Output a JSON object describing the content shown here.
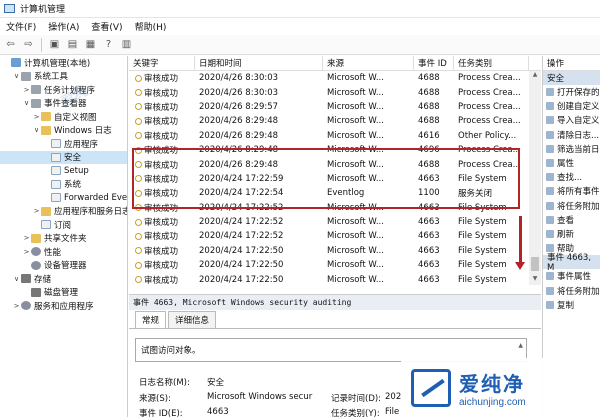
{
  "window": {
    "title": "计算机管理"
  },
  "menu": [
    "文件(F)",
    "操作(A)",
    "查看(V)",
    "帮助(H)"
  ],
  "tree": [
    {
      "label": "计算机管理(本地)",
      "indent": 0,
      "arrow": "",
      "icon": "pc"
    },
    {
      "label": "系统工具",
      "indent": 1,
      "arrow": "∨",
      "icon": "tool"
    },
    {
      "label": "任务计划程序",
      "indent": 2,
      "arrow": ">",
      "icon": "tool"
    },
    {
      "label": "事件查看器",
      "indent": 2,
      "arrow": "∨",
      "icon": "tool"
    },
    {
      "label": "自定义视图",
      "indent": 3,
      "arrow": ">",
      "icon": "folder"
    },
    {
      "label": "Windows 日志",
      "indent": 3,
      "arrow": "∨",
      "icon": "folder"
    },
    {
      "label": "应用程序",
      "indent": 4,
      "arrow": "",
      "icon": "log"
    },
    {
      "label": "安全",
      "indent": 4,
      "arrow": "",
      "icon": "log",
      "selected": true
    },
    {
      "label": "Setup",
      "indent": 4,
      "arrow": "",
      "icon": "log"
    },
    {
      "label": "系统",
      "indent": 4,
      "arrow": "",
      "icon": "log"
    },
    {
      "label": "Forwarded Eve",
      "indent": 4,
      "arrow": "",
      "icon": "log"
    },
    {
      "label": "应用程序和服务日志",
      "indent": 3,
      "arrow": ">",
      "icon": "folder"
    },
    {
      "label": "订阅",
      "indent": 3,
      "arrow": "",
      "icon": "log"
    },
    {
      "label": "共享文件夹",
      "indent": 2,
      "arrow": ">",
      "icon": "folder"
    },
    {
      "label": "性能",
      "indent": 2,
      "arrow": ">",
      "icon": "gear"
    },
    {
      "label": "设备管理器",
      "indent": 2,
      "arrow": "",
      "icon": "gear"
    },
    {
      "label": "存储",
      "indent": 1,
      "arrow": "∨",
      "icon": "disk"
    },
    {
      "label": "磁盘管理",
      "indent": 2,
      "arrow": "",
      "icon": "disk"
    },
    {
      "label": "服务和应用程序",
      "indent": 1,
      "arrow": ">",
      "icon": "gear"
    }
  ],
  "grid": {
    "headers": [
      "关键字",
      "日期和时间",
      "来源",
      "事件 ID",
      "任务类别"
    ],
    "rows": [
      [
        "审核成功",
        "2020/4/26 8:30:03",
        "Microsoft W...",
        "4688",
        "Process Crea..."
      ],
      [
        "审核成功",
        "2020/4/26 8:30:03",
        "Microsoft W...",
        "4688",
        "Process Crea..."
      ],
      [
        "审核成功",
        "2020/4/26 8:29:57",
        "Microsoft W...",
        "4688",
        "Process Crea..."
      ],
      [
        "审核成功",
        "2020/4/26 8:29:48",
        "Microsoft W...",
        "4688",
        "Process Crea..."
      ],
      [
        "审核成功",
        "2020/4/26 8:29:48",
        "Microsoft W...",
        "4616",
        "Other Policy..."
      ],
      [
        "审核成功",
        "2020/4/26 8:29:48",
        "Microsoft W...",
        "4696",
        "Process Crea..."
      ],
      [
        "审核成功",
        "2020/4/26 8:29:48",
        "Microsoft W...",
        "4688",
        "Process Crea..."
      ],
      [
        "审核成功",
        "2020/4/24 17:22:59",
        "Microsoft W...",
        "4663",
        "File System"
      ],
      [
        "审核成功",
        "2020/4/24 17:22:54",
        "Eventlog",
        "1100",
        "服务关闭"
      ],
      [
        "审核成功",
        "2020/4/24 17:22:52",
        "Microsoft W...",
        "4663",
        "File System"
      ],
      [
        "审核成功",
        "2020/4/24 17:22:52",
        "Microsoft W...",
        "4663",
        "File System"
      ],
      [
        "审核成功",
        "2020/4/24 17:22:52",
        "Microsoft W...",
        "4663",
        "File System"
      ],
      [
        "审核成功",
        "2020/4/24 17:22:50",
        "Microsoft W...",
        "4663",
        "File System"
      ],
      [
        "审核成功",
        "2020/4/24 17:22:50",
        "Microsoft W...",
        "4663",
        "File System"
      ],
      [
        "审核成功",
        "2020/4/24 17:22:50",
        "Microsoft W...",
        "4663",
        "File System"
      ]
    ]
  },
  "detail": {
    "title": "事件 4663, Microsoft Windows security auditing",
    "tabs": [
      "常规",
      "详细信息"
    ],
    "description": "试图访问对象。",
    "props": {
      "log_name_label": "日志名称(M):",
      "log_name_value": "安全",
      "source_label": "来源(S):",
      "source_value": "Microsoft Windows secur",
      "recorded_label": "记录时间(D):",
      "recorded_value": "202",
      "event_id_label": "事件 ID(E):",
      "event_id_value": "4663",
      "task_label": "任务类别(Y):",
      "task_value": "File"
    }
  },
  "actions": {
    "header": "操作",
    "section1": "安全",
    "items1": [
      "打开保存的",
      "创建自定义",
      "导入自定义",
      "清除日志...",
      "筛选当前日",
      "属性",
      "查找...",
      "将所有事件",
      "将任务附加",
      "查看",
      "刷新",
      "帮助"
    ],
    "section2": "事件 4663, M",
    "items2": [
      "事件属性",
      "将任务附加",
      "复制"
    ]
  },
  "watermark": {
    "big": "爱纯净",
    "small": "aichunjing.com",
    "faint": "爱纯"
  }
}
